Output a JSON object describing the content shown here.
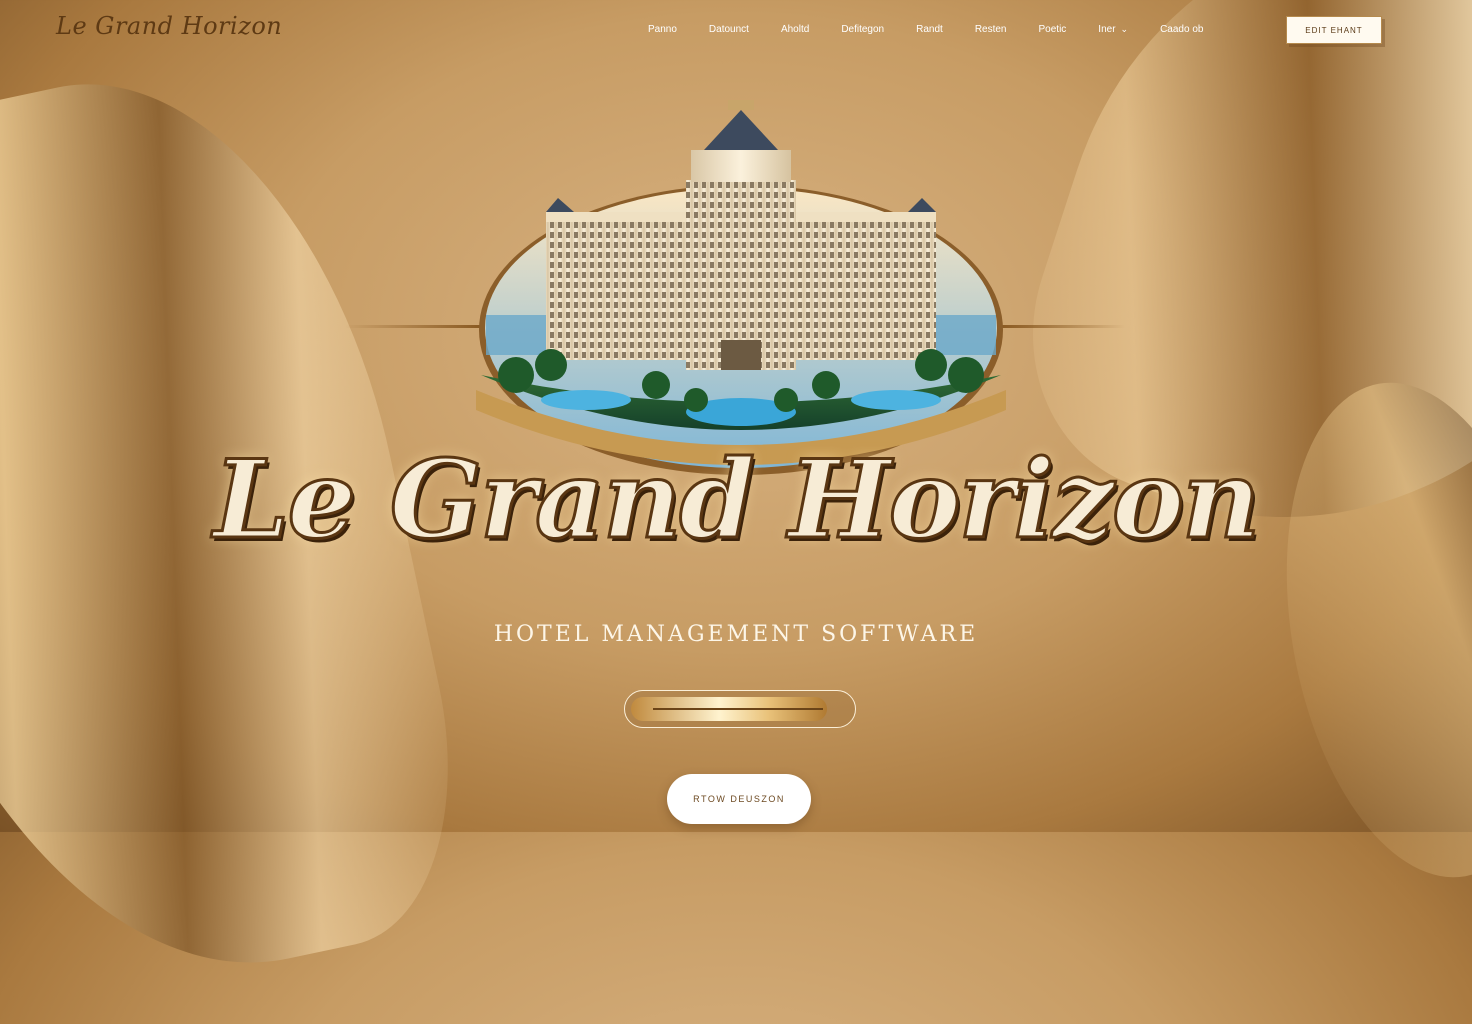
{
  "brand": {
    "logo_text": "Le Grand Horizon",
    "wordmark": "Le Grand Horizon",
    "subtitle": "HOTEL MANAGEMENT SOFTWARE"
  },
  "nav": {
    "items": [
      {
        "label": "Panno"
      },
      {
        "label": "Datounct"
      },
      {
        "label": "Aholtd"
      },
      {
        "label": "Defitegon"
      },
      {
        "label": "Randt"
      },
      {
        "label": "Resten"
      },
      {
        "label": "Poetic"
      },
      {
        "label": "Iner",
        "has_dropdown": true
      },
      {
        "label": "Caado ob"
      }
    ]
  },
  "header": {
    "cta_label": "EDIT EHANT"
  },
  "hero": {
    "progress_percent": 90,
    "cta_label": "RTOW DEUSZON"
  },
  "colors": {
    "gold_dark": "#5e3a14",
    "gold_light": "#f7ecd6",
    "background": "#c79c64"
  }
}
